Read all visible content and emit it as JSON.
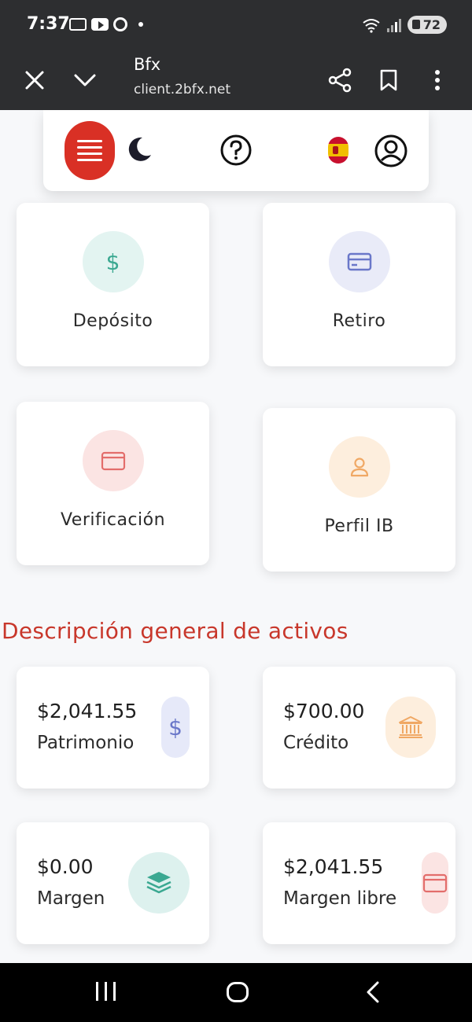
{
  "status_bar": {
    "time": "7:37",
    "battery": "72"
  },
  "browser": {
    "title": "Bfx",
    "url": "client.2bfx.net"
  },
  "actions": [
    {
      "label": "Depósito",
      "icon": "dollar-icon",
      "bg": "#e3f4f1",
      "fg": "#3aa891"
    },
    {
      "label": "Retiro",
      "icon": "credit-card-icon",
      "bg": "#e9ebf8",
      "fg": "#6a77c9"
    },
    {
      "label": "Verificación",
      "icon": "id-card-icon",
      "bg": "#fbe4e3",
      "fg": "#e36d6b"
    },
    {
      "label": "Perfil IB",
      "icon": "user-icon",
      "bg": "#fdeedd",
      "fg": "#f0a864"
    }
  ],
  "section_title": "Descripción general de activos",
  "assets": [
    {
      "amount": "$2,041.55",
      "label": "Patrimonio",
      "icon": "dollar-icon"
    },
    {
      "amount": "$700.00",
      "label": "Crédito",
      "icon": "bank-icon"
    },
    {
      "amount": "$0.00",
      "label": "Margen",
      "icon": "layers-icon"
    },
    {
      "amount": "$2,041.55",
      "label": "Margen libre",
      "icon": "wallet-icon"
    }
  ],
  "colors": {
    "accent": "#d93025",
    "section_title": "#c8372b",
    "toolbar": "#2d2e30"
  }
}
